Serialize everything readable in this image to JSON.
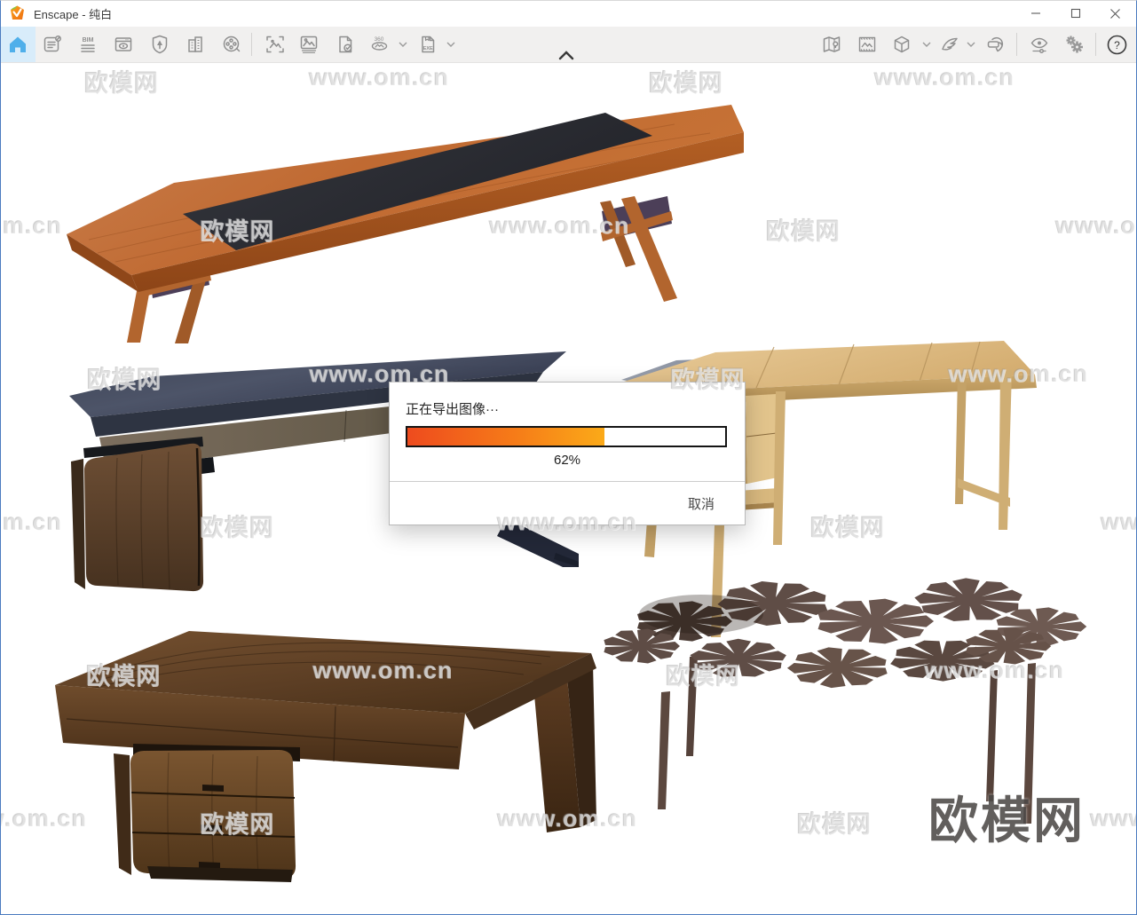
{
  "titlebar": {
    "title": "Enscape - 纯白",
    "controls": [
      "minimize",
      "maximize",
      "close"
    ]
  },
  "toolbar": {
    "icons_left": [
      "home-icon",
      "feedback-notes-icon",
      "bim-mode-icon",
      "view-management-icon",
      "asset-library-icon",
      "site-context-icon",
      "video-editor-icon"
    ],
    "icons_capture": [
      "screenshot-icon",
      "batch-rendering-icon",
      "render-image-icon",
      "mono-panorama-icon",
      "exe-standalone-icon"
    ],
    "icons_right": [
      "map-location-icon",
      "material-library-icon",
      "orbit-mode-icon",
      "fly-mode-icon",
      "vr-headset-icon",
      "visual-settings-icon",
      "general-settings-icon",
      "help-icon"
    ],
    "bim_label": "BIM",
    "pano_label": "360",
    "exe_label": "EXE",
    "help_label": "?"
  },
  "dialog": {
    "title": "正在导出图像···",
    "percent": "62%",
    "progress_value": 62,
    "progress_style": "width:62%",
    "cancel": "取消"
  },
  "watermarks": {
    "items": [
      "欧模网",
      "www.om.cn",
      "欧模网",
      "www.om.cn",
      "www.om.cn",
      "欧模网",
      "www.om.cn",
      "欧模网",
      "www.om.cn",
      "欧模网",
      "www.om.cn",
      "欧模网",
      "www.om.cn",
      "www.om.cn",
      "欧模网",
      "www.om.cn",
      "欧模网",
      "www.om.cn",
      "欧模网",
      "www.om.cn",
      "欧模网",
      "www.om.cn",
      "www.om.cn",
      "欧模网",
      "www.om.cn",
      "欧模网",
      "www.om.cn"
    ],
    "logo": "欧模网"
  },
  "scene": {
    "items": [
      "teak-bench-with-inlay",
      "dark-navy-desk-wood-cabinet",
      "light-oak-writing-desk",
      "walnut-executive-desk",
      "monstera-leaf-coffee-table"
    ]
  },
  "colors": {
    "accent_home_blue": "#4fafea",
    "logo_orange": "#f7941e",
    "progress_gradient_start": "#ee4b1e",
    "progress_gradient_end": "#fbaa18",
    "window_border_blue": "#4b7bbf",
    "toolbar_bg": "#f1f0ef"
  }
}
